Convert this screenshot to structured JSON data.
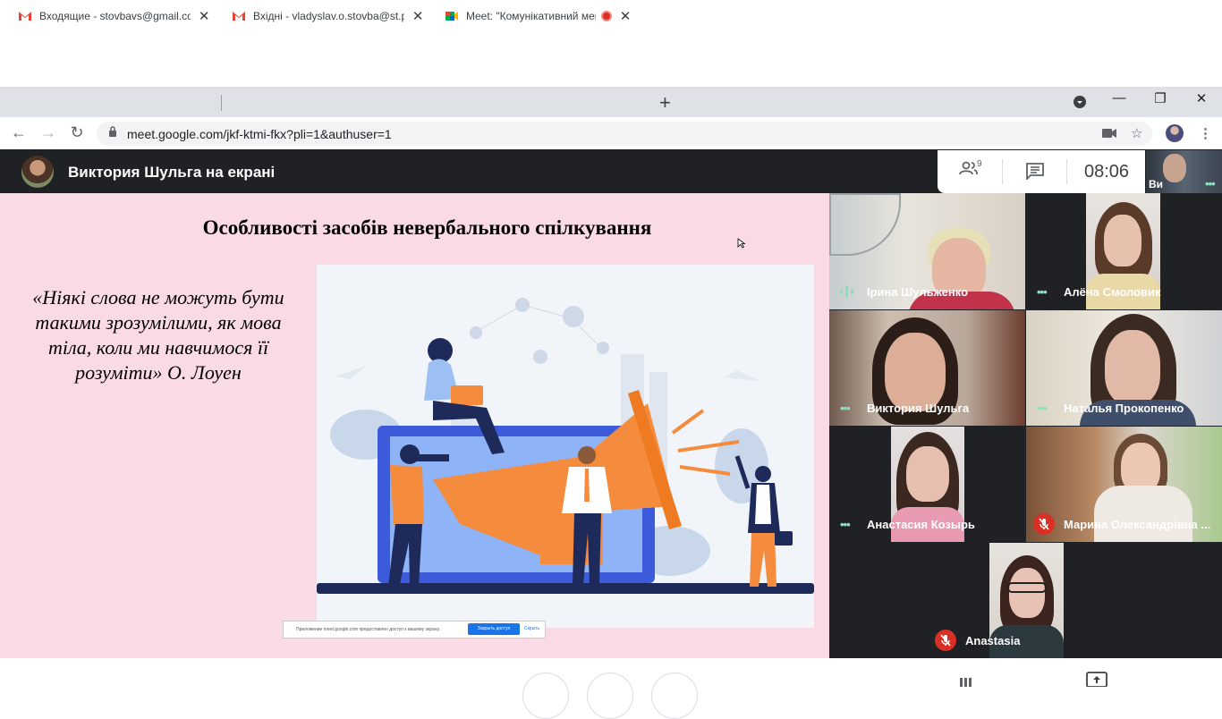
{
  "browser": {
    "tabs": [
      {
        "title": "Входящие - stovbavs@gmail.com",
        "icon": "gmail-icon",
        "active": false
      },
      {
        "title": "Вхідні - vladyslav.o.stovba@st.pdpu.edu.ua",
        "icon": "gmail-icon",
        "active": false
      },
      {
        "title": "Meet: \"Комунікативний менеджмент\"",
        "icon": "meet-icon",
        "active": true,
        "recording": true
      }
    ],
    "new_tab_label": "+",
    "window_controls": {
      "minimize": "—",
      "maximize": "❐",
      "close": "✕"
    },
    "tab_close": "✕",
    "url": "meet.google.com/jkf-ktmi-fkx?pli=1&authuser=1"
  },
  "meet": {
    "presenter_title": "Виктория Шульга на екрані",
    "people_count": "9",
    "time": "08:06",
    "self_name": "Ви"
  },
  "slide": {
    "title": "Особливості засобів невербального спілкування",
    "quote_lines": [
      "«Ніякі слова не можуть бути",
      "такими зрозумілими, як мова",
      "тіла, коли ми навчимося її",
      "розуміти» О. Лоуен"
    ],
    "share_notice": "Приложение meet.google.com предоставлен доступ к вашему экрану.",
    "share_stop_label": "Закрыть доступ",
    "share_hide_label": "Скрыть"
  },
  "participants": [
    {
      "name": "Ірина Шульженко",
      "status": "speaking"
    },
    {
      "name": "Алёна Смоловик",
      "status": "more"
    },
    {
      "name": "Виктория Шульга",
      "status": "more"
    },
    {
      "name": "Наталья Прокопенко",
      "status": "more"
    },
    {
      "name": "Анастасия Козырь",
      "status": "more"
    },
    {
      "name": "Марина Олександрівна ...",
      "status": "muted"
    },
    {
      "name": "Anastasia",
      "status": "muted"
    }
  ],
  "colors": {
    "slide_bg": "#fadbe5",
    "meet_dark": "#202124",
    "accent_green": "#8ae1c0",
    "mute_red": "#d93025",
    "megaphone_orange": "#f58b3c",
    "laptop_blue": "#3b5bdb"
  }
}
